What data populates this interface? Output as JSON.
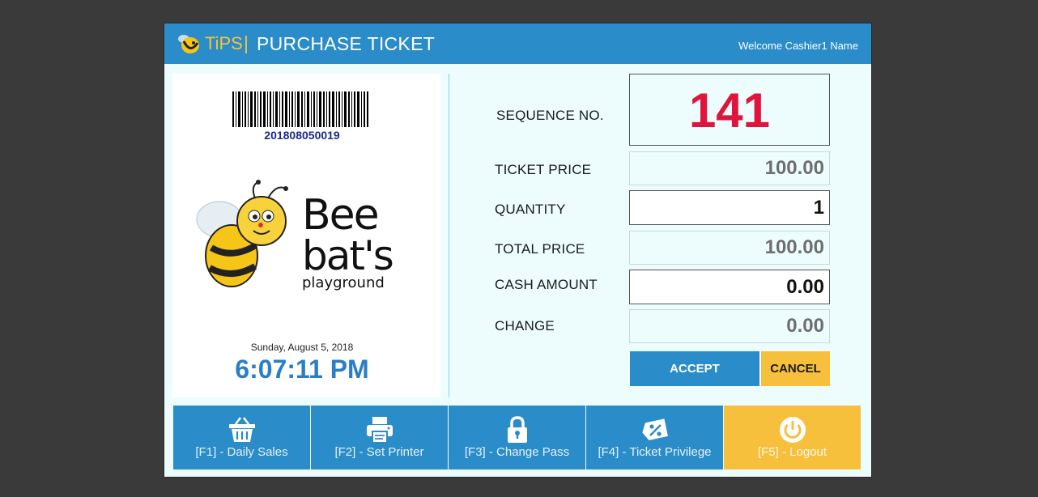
{
  "window": {
    "app_name": "TiPS",
    "separator": "|",
    "page_title": "PURCHASE TICKET",
    "welcome": "Welcome Cashier1 Name"
  },
  "ticket": {
    "barcode_number": "201808050019",
    "brand_logo": "Bee bat's playground",
    "date": "Sunday, August 5, 2018",
    "time": "6:07:11 PM"
  },
  "form": {
    "sequence_label": "SEQUENCE NO.",
    "sequence_value": "141",
    "ticket_price_label": "TICKET PRICE",
    "ticket_price_value": "100.00",
    "quantity_label": "QUANTITY",
    "quantity_value": "1",
    "total_price_label": "TOTAL PRICE",
    "total_price_value": "100.00",
    "cash_amount_label": "CASH AMOUNT",
    "cash_amount_value": "0.00",
    "change_label": "CHANGE",
    "change_value": "0.00"
  },
  "actions": {
    "accept_label": "ACCEPT",
    "cancel_label": "CANCEL"
  },
  "function_keys": [
    {
      "label": "[F1] - Daily Sales",
      "icon": "basket-icon"
    },
    {
      "label": "[F2] - Set Printer",
      "icon": "printer-icon"
    },
    {
      "label": "[F3] - Change Pass",
      "icon": "lock-icon"
    },
    {
      "label": "[F4] - Ticket Privilege",
      "icon": "discount-tag-icon"
    },
    {
      "label": "[F5] - Logout",
      "icon": "power-icon"
    }
  ],
  "colors": {
    "header_blue": "#2a8cc8",
    "accent_yellow": "#f6c03c",
    "sequence_red": "#e0143c",
    "panel_background": "#edfdfd"
  }
}
